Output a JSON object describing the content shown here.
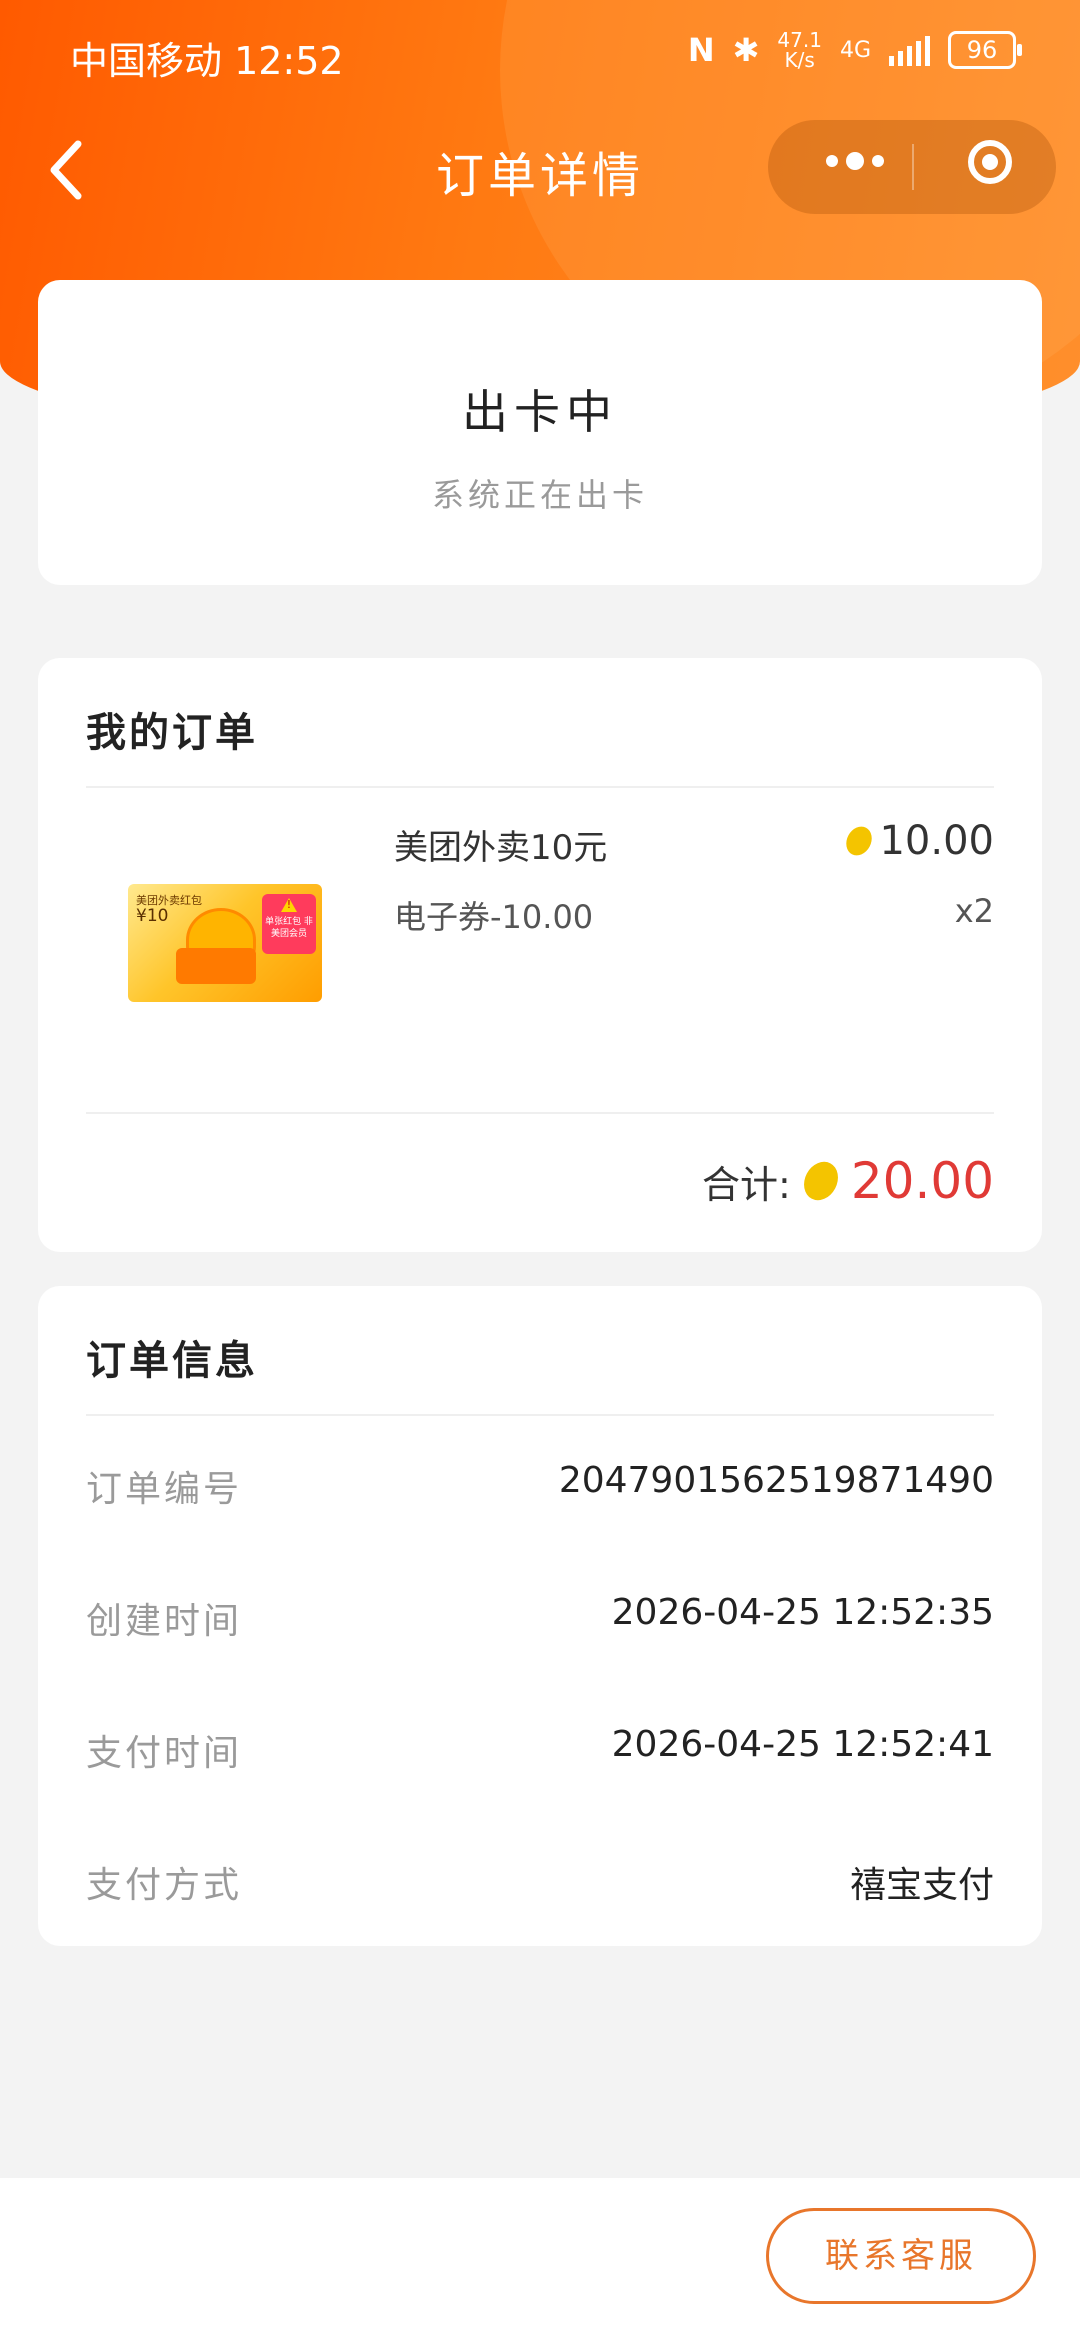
{
  "status_bar": {
    "carrier_time": "中国移动 12:52",
    "net_speed_value": "47.1",
    "net_speed_unit": "K/s",
    "network": "4G",
    "battery": "96"
  },
  "nav": {
    "title": "订单详情"
  },
  "order_status": {
    "title": "出卡中",
    "description": "系统正在出卡"
  },
  "my_order": {
    "heading": "我的订单",
    "item": {
      "thumbnail_title": "美团外卖红包",
      "thumbnail_value": "¥10",
      "thumbnail_tag": "单张红包 非美团会员",
      "name": "美团外卖10元",
      "spec": "电子券-10.00",
      "price": "10.00",
      "quantity": "x2"
    },
    "total_label": "合计:",
    "total_value": "20.00"
  },
  "order_info": {
    "heading": "订单信息",
    "rows": [
      {
        "label": "订单编号",
        "value": "2047901562519871490"
      },
      {
        "label": "创建时间",
        "value": "2026-04-25 12:52:35"
      },
      {
        "label": "支付时间",
        "value": "2026-04-25 12:52:41"
      },
      {
        "label": "支付方式",
        "value": "禧宝支付"
      }
    ]
  },
  "footer": {
    "contact_label": "联系客服"
  },
  "colors": {
    "brand_orange": "#ff6a00",
    "price_red": "#e03a36",
    "button_border": "#e8762b"
  }
}
